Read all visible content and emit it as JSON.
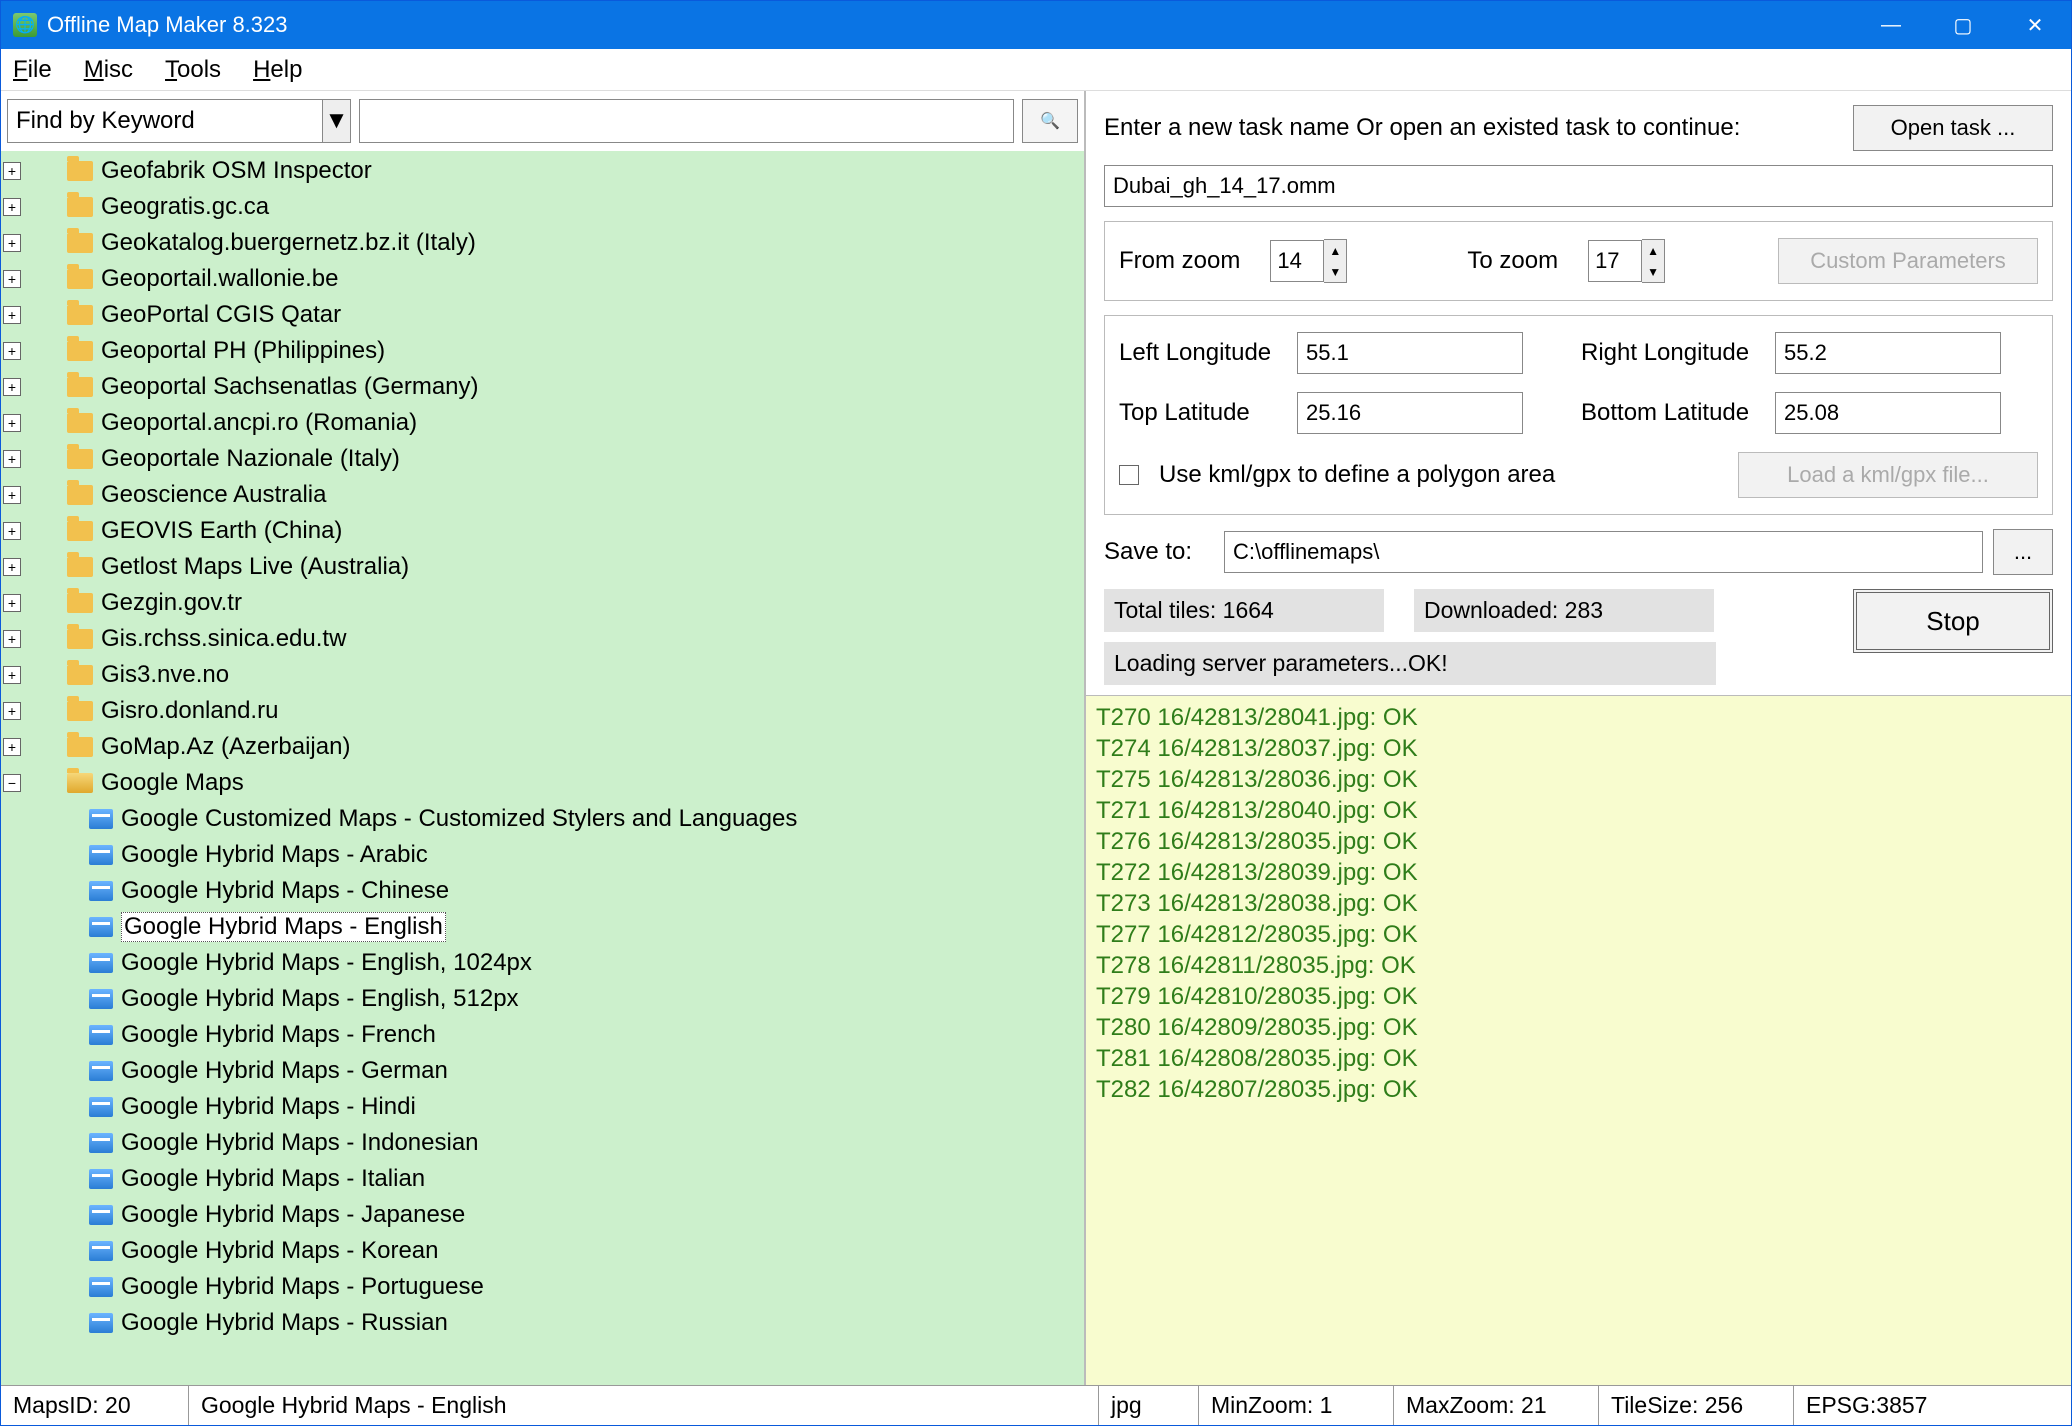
{
  "window": {
    "title": "Offline Map Maker 8.323"
  },
  "menu": {
    "file": "File",
    "misc": "Misc",
    "tools": "Tools",
    "help": "Help"
  },
  "search": {
    "combo": "Find by Keyword",
    "value": ""
  },
  "tree": {
    "folders": [
      "Geofabrik OSM Inspector",
      "Geogratis.gc.ca",
      "Geokatalog.buergernetz.bz.it (Italy)",
      "Geoportail.wallonie.be",
      "GeoPortal CGIS Qatar",
      "Geoportal PH (Philippines)",
      "Geoportal Sachsenatlas (Germany)",
      "Geoportal.ancpi.ro (Romania)",
      "Geoportale Nazionale (Italy)",
      "Geoscience Australia",
      "GEOVIS Earth (China)",
      "Getlost Maps Live (Australia)",
      "Gezgin.gov.tr",
      "Gis.rchss.sinica.edu.tw",
      "Gis3.nve.no",
      "Gisro.donland.ru",
      "GoMap.Az (Azerbaijan)"
    ],
    "open_folder": "Google Maps",
    "children": [
      "Google Customized Maps - Customized Stylers and Languages",
      "Google Hybrid Maps - Arabic",
      "Google Hybrid Maps - Chinese",
      "Google Hybrid Maps - English",
      "Google Hybrid Maps - English, 1024px",
      "Google Hybrid Maps - English, 512px",
      "Google Hybrid Maps - French",
      "Google Hybrid Maps - German",
      "Google Hybrid Maps - Hindi",
      "Google Hybrid Maps - Indonesian",
      "Google Hybrid Maps - Italian",
      "Google Hybrid Maps - Japanese",
      "Google Hybrid Maps - Korean",
      "Google Hybrid Maps - Portuguese",
      "Google Hybrid Maps - Russian"
    ],
    "selected_index": 3
  },
  "task": {
    "prompt": "Enter a new task name Or open an existed task to continue:",
    "open_btn": "Open task ...",
    "name": "Dubai_gh_14_17.omm",
    "from_zoom_lbl": "From zoom",
    "from_zoom": "14",
    "to_zoom_lbl": "To zoom",
    "to_zoom": "17",
    "custom_params": "Custom Parameters",
    "left_long_lbl": "Left Longitude",
    "left_long": "55.1",
    "right_long_lbl": "Right Longitude",
    "right_long": "55.2",
    "top_lat_lbl": "Top Latitude",
    "top_lat": "25.16",
    "bottom_lat_lbl": "Bottom Latitude",
    "bottom_lat": "25.08",
    "kml_chk": "Use kml/gpx to define a polygon area",
    "kml_btn": "Load a kml/gpx file...",
    "save_to_lbl": "Save to:",
    "save_to": "C:\\offlinemaps\\",
    "browse": "...",
    "total": "Total tiles: 1664",
    "downloaded": "Downloaded: 283",
    "statusmsg": "Loading server parameters...OK!",
    "stop": "Stop"
  },
  "log": [
    "T270 16/42813/28041.jpg: OK",
    "T274 16/42813/28037.jpg: OK",
    "T275 16/42813/28036.jpg: OK",
    "T271 16/42813/28040.jpg: OK",
    "T276 16/42813/28035.jpg: OK",
    "T272 16/42813/28039.jpg: OK",
    "T273 16/42813/28038.jpg: OK",
    "T277 16/42812/28035.jpg: OK",
    "T278 16/42811/28035.jpg: OK",
    "T279 16/42810/28035.jpg: OK",
    "T280 16/42809/28035.jpg: OK",
    "T281 16/42808/28035.jpg: OK",
    "T282 16/42807/28035.jpg: OK"
  ],
  "status": {
    "mapsid": "MapsID: 20",
    "selected": "Google Hybrid Maps - English",
    "format": "jpg",
    "minzoom": "MinZoom: 1",
    "maxzoom": "MaxZoom: 21",
    "tilesize": "TileSize: 256",
    "epsg": "EPSG:3857"
  }
}
